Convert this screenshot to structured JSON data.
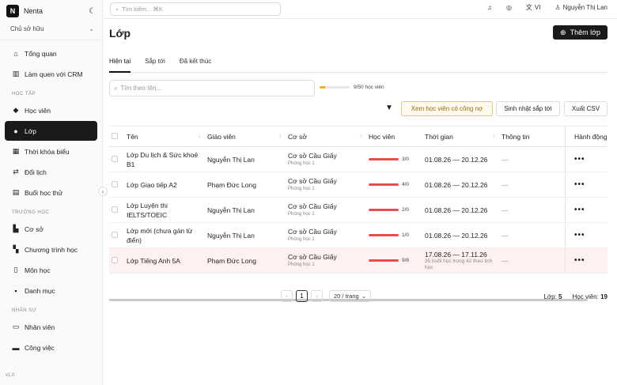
{
  "brand": {
    "initial": "N",
    "name": "Nenta"
  },
  "role": "Chủ sở hữu",
  "sidebar": {
    "top": [
      {
        "label": "Tổng quan"
      },
      {
        "label": "Làm quen với CRM"
      }
    ],
    "section_learning": "HỌC TẬP",
    "learning": [
      {
        "label": "Học viên"
      },
      {
        "label": "Lớp"
      },
      {
        "label": "Thời khóa biểu"
      },
      {
        "label": "Đổi lịch"
      },
      {
        "label": "Buổi học thử"
      }
    ],
    "section_school": "TRƯỜNG HỌC",
    "school": [
      {
        "label": "Cơ sở"
      },
      {
        "label": "Chương trình học"
      },
      {
        "label": "Môn học"
      },
      {
        "label": "Danh mục"
      }
    ],
    "section_hr": "NHÂN SỰ",
    "hr": [
      {
        "label": "Nhân viên"
      },
      {
        "label": "Công việc"
      }
    ],
    "version": "v1.0"
  },
  "topbar": {
    "search_placeholder": "Tìm kiếm... ⌘K",
    "lang": "VI",
    "user": "Nguyễn Thị Lan"
  },
  "page": {
    "title": "Lớp",
    "add_label": "Thêm lớp"
  },
  "tabs": [
    {
      "label": "Hiện tại"
    },
    {
      "label": "Sắp tới"
    },
    {
      "label": "Đã kết thúc"
    }
  ],
  "filter": {
    "placeholder": "Tìm theo tên...",
    "quota_text": "9/50 học viên",
    "quota_fraction": 0.18
  },
  "actions": {
    "debt": "Xem học viên có công nợ",
    "update": "Sinh nhật sắp tới",
    "export": "Xuất CSV"
  },
  "table": {
    "headers": {
      "name": "Tên",
      "teacher": "Giáo viên",
      "base": "Cơ sở",
      "students": "Học viên",
      "time": "Thời gian",
      "info": "Thông tin",
      "action": "Hành động"
    },
    "rows": [
      {
        "name": "Lớp Du lịch & Sức khoẻ B1",
        "teacher": "Nguyễn Thị Lan",
        "base": "Cơ sở Cầu Giấy",
        "room": "Phòng học 1",
        "count": "3/0",
        "fill": 1.0,
        "time": "01.08.26 — 20.12.26",
        "time_sub": "",
        "info": "—",
        "act": "•••"
      },
      {
        "name": "Lớp Giao tiếp A2",
        "teacher": "Phạm Đức Long",
        "base": "Cơ sở Cầu Giấy",
        "room": "Phòng học 1",
        "count": "4/0",
        "fill": 1.0,
        "time": "01.08.26 — 20.12.26",
        "time_sub": "",
        "info": "—",
        "act": "•••"
      },
      {
        "name": "Lớp Luyện thi IELTS/TOEIC",
        "teacher": "Nguyễn Thị Lan",
        "base": "Cơ sở Cầu Giấy",
        "room": "Phòng học 1",
        "count": "2/0",
        "fill": 1.0,
        "time": "01.08.26 — 20.12.26",
        "time_sub": "",
        "info": "—",
        "act": "•••"
      },
      {
        "name": "Lớp mới (chưa gán từ điển)",
        "teacher": "Nguyễn Thị Lan",
        "base": "Cơ sở Cầu Giấy",
        "room": "Phòng học 1",
        "count": "1/0",
        "fill": 1.0,
        "time": "01.08.26 — 20.12.26",
        "time_sub": "",
        "info": "—",
        "act": "•••"
      },
      {
        "name": "Lớp Tiếng Anh 5A",
        "teacher": "Phạm Đức Long",
        "base": "Cơ sở Cầu Giấy",
        "room": "Phòng học 1",
        "count": "9/8",
        "fill": 1.0,
        "time": "17.08.26 — 17.11.26",
        "time_sub": "35 buổi học trong 42 theo lịch học",
        "info": "—",
        "act": "•••"
      }
    ]
  },
  "pagination": {
    "prev": "‹",
    "current": "1",
    "next": "›",
    "page_size": "20 / trang"
  },
  "totals": {
    "classes_label": "Lớp:",
    "classes": "5",
    "students_label": "Học viên:",
    "students": "19"
  }
}
